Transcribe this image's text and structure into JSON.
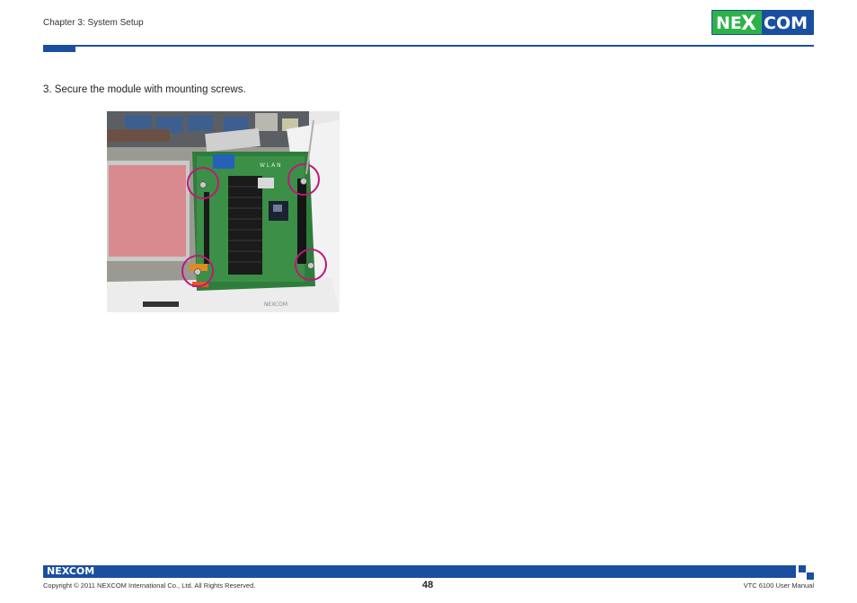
{
  "header": {
    "chapter": "Chapter 3: System Setup",
    "logo_text": "NE COM",
    "logo_x": "X"
  },
  "content": {
    "step": "3.  Secure the module with mounting screws.",
    "photo_labels": {
      "wlan": "W L A N"
    }
  },
  "footer": {
    "logo_text": "NEXCOM",
    "copyright": "Copyright © 2011 NEXCOM International Co., Ltd. All Rights Reserved.",
    "page_number": "48",
    "manual": "VTC 6100 User Manual"
  },
  "colors": {
    "brand_blue": "#1a4fa0",
    "brand_green": "#2db24a",
    "highlight_circle": "#c0177a"
  }
}
